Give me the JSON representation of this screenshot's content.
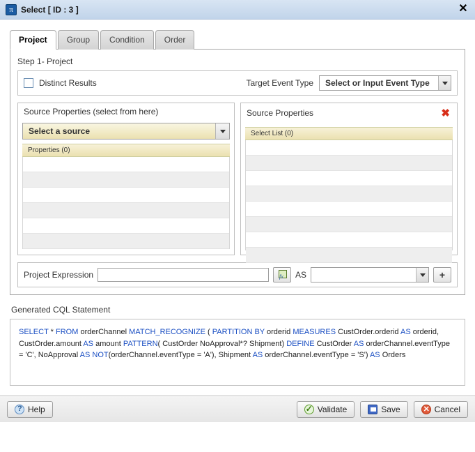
{
  "window": {
    "title": "Select [ ID : 3 ]",
    "icon_glyph": "π"
  },
  "tabs": [
    "Project",
    "Group",
    "Condition",
    "Order"
  ],
  "active_tab_index": 0,
  "step_label": "Step 1- Project",
  "distinct": {
    "label": "Distinct Results",
    "checked": false
  },
  "target_event_type": {
    "label": "Target Event Type",
    "placeholder": "Select or Input Event Type",
    "value": ""
  },
  "left_panel": {
    "title": "Source Properties (select from here)",
    "source_select": "Select a source",
    "grid_header": "Properties (0)",
    "rows": [
      "",
      "",
      "",
      "",
      "",
      ""
    ]
  },
  "right_panel": {
    "title": "Source Properties",
    "grid_header": "Select List (0)",
    "rows": [
      "",
      "",
      "",
      "",
      "",
      "",
      "",
      ""
    ]
  },
  "expression": {
    "label": "Project Expression",
    "value": "",
    "as_label": "AS",
    "as_value": "",
    "add_label": "+"
  },
  "generated": {
    "label": "Generated CQL Statement",
    "tokens": [
      {
        "t": "SELECT",
        "k": true
      },
      {
        "t": " * "
      },
      {
        "t": "FROM",
        "k": true
      },
      {
        "t": " orderChannel  "
      },
      {
        "t": "MATCH_RECOGNIZE",
        "k": true
      },
      {
        "t": " ( "
      },
      {
        "t": "PARTITION BY",
        "k": true
      },
      {
        "t": " orderid "
      },
      {
        "t": "MEASURES",
        "k": true
      },
      {
        "t": " CustOrder.orderid "
      },
      {
        "t": "AS",
        "k": true
      },
      {
        "t": " orderid, CustOrder.amount "
      },
      {
        "t": "AS",
        "k": true
      },
      {
        "t": " amount "
      },
      {
        "t": "PATTERN",
        "k": true
      },
      {
        "t": "( CustOrder NoApproval*? Shipment) "
      },
      {
        "t": "DEFINE",
        "k": true
      },
      {
        "t": " CustOrder "
      },
      {
        "t": "AS",
        "k": true
      },
      {
        "t": " orderChannel.eventType = 'C', NoApproval "
      },
      {
        "t": "AS",
        "k": true
      },
      {
        "t": " "
      },
      {
        "t": "NOT",
        "k": true
      },
      {
        "t": "(orderChannel.eventType = 'A'), Shipment "
      },
      {
        "t": "AS",
        "k": true
      },
      {
        "t": " orderChannel.eventType = 'S') "
      },
      {
        "t": "AS",
        "k": true
      },
      {
        "t": " Orders"
      }
    ]
  },
  "buttons": {
    "help": "Help",
    "validate": "Validate",
    "save": "Save",
    "cancel": "Cancel"
  }
}
